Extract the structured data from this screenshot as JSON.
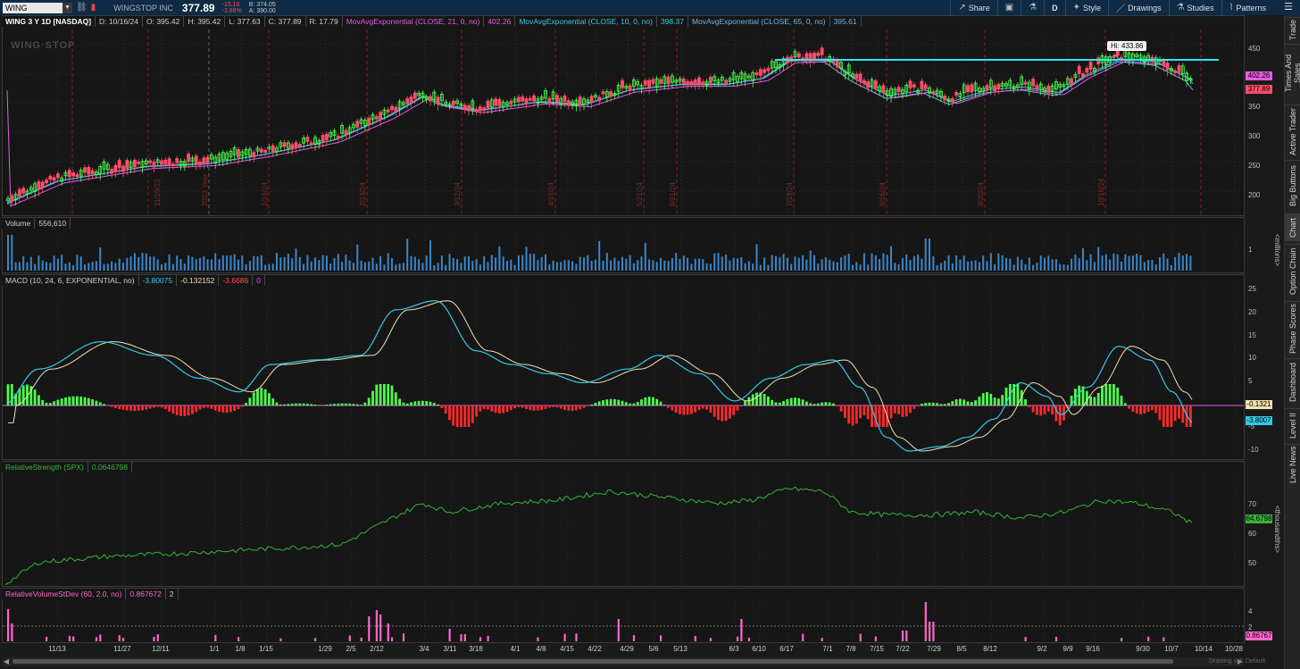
{
  "topbar": {
    "symbol": "WING",
    "company": "WINGSTOP INC",
    "last": "377.89",
    "change": "-15.16",
    "change_pct": "-3.86%",
    "bid": "B: 374.05",
    "ask": "A: 390.00",
    "buttons": {
      "share": "Share",
      "period": "D",
      "style": "Style",
      "drawings": "Drawings",
      "studies": "Studies",
      "patterns": "Patterns"
    }
  },
  "price_panel": {
    "header": [
      "WING 3 Y 1D [NASDAQ]",
      "D: 10/16/24",
      "O: 395.42",
      "H: 395.42",
      "L: 377.63",
      "C: 377.89",
      "R: 17.79"
    ],
    "ema": [
      {
        "label": "MovAvgExponential (CLOSE, 21, 0, no)",
        "value": "402.26",
        "color": "#e05ee0"
      },
      {
        "label": "MovAvgExponential (CLOSE, 10, 0, no)",
        "value": "398.37",
        "color": "#33c9e6"
      },
      {
        "label": "MovAvgExponential (CLOSE, 65, 0, no)",
        "value": "395.61",
        "color": "#6fb6e6"
      }
    ],
    "watermark": "WING·STOP",
    "hi_label": "Hi: 433.86",
    "y_ticks": [
      "450",
      "400",
      "350",
      "300",
      "250",
      "200"
    ],
    "tag_ema": "402.26",
    "tag_last": "377.89",
    "dates_rotated": [
      "11/29/23",
      "2023 Year",
      "1/16/24",
      "2/13/24",
      "3/12/24",
      "4/16/24",
      "5/21/24",
      "6/21/24",
      "7/18/24",
      "8/16/24",
      "9/20/24",
      "10/16/24"
    ]
  },
  "volume_panel": {
    "header": [
      "Volume",
      "556,610"
    ],
    "y_ticks": [
      "1"
    ],
    "unit": "<millions>"
  },
  "macd_panel": {
    "header": [
      "MACD (10, 24, 6, EXPONENTIAL, no)",
      "-3.80075",
      "-0.132152",
      "-3.6686",
      "0"
    ],
    "y_ticks": [
      "25",
      "20",
      "15",
      "10",
      "5",
      "0",
      "-5",
      "-10"
    ],
    "tag_signal": "-0.1321",
    "tag_macd": "-3.8007"
  },
  "rs_panel": {
    "header": [
      "RelativeStrength (SPX)",
      "0.0646798"
    ],
    "y_ticks": [
      "70",
      "60",
      "50"
    ],
    "tag": "64.6798",
    "unit": "<thousandths>"
  },
  "rvsd_panel": {
    "header": [
      "RelativeVolumeStDev (60, 2.0, no)",
      "0.867672",
      "2"
    ],
    "y_ticks": [
      "4",
      "2"
    ],
    "tag": "0.86767"
  },
  "x_axis": [
    "11/13",
    "11/27",
    "12/11",
    "1/1",
    "1/8",
    "1/15",
    "1/29",
    "2/5",
    "2/12",
    "3/4",
    "3/11",
    "3/18",
    "4/1",
    "4/8",
    "4/15",
    "4/22",
    "4/29",
    "5/6",
    "5/13",
    "6/3",
    "6/10",
    "6/17",
    "7/1",
    "7/8",
    "7/15",
    "7/22",
    "7/29",
    "8/5",
    "8/12",
    "9/2",
    "9/9",
    "9/16",
    "9/30",
    "10/7",
    "10/14",
    "10/28"
  ],
  "side_tabs": [
    "Trade",
    "Times And Sales",
    "Active Trader",
    "Big Buttons",
    "Chart",
    "Option Chain",
    "Phase Scores",
    "Dashboard",
    "Level II",
    "Live News"
  ],
  "status": "Drawing set: Default",
  "colors": {
    "up": "#4cff4c",
    "down": "#ff4d6a",
    "hline": "#2ee6f0",
    "macd": "#33c9e6",
    "signal": "#f0e0b0",
    "rs": "#39b339",
    "rvsd": "#ff66cc",
    "vol": "#3a86c8"
  }
}
